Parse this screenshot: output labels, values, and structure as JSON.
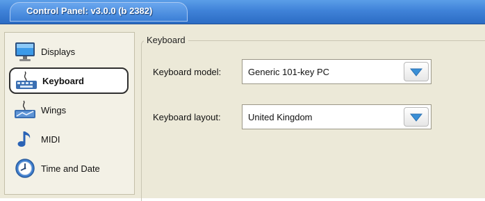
{
  "window": {
    "title": "Control Panel: v3.0.0 (b 2382)"
  },
  "sidebar": {
    "items": [
      {
        "label": "Displays",
        "icon": "monitor-icon",
        "selected": false
      },
      {
        "label": "Keyboard",
        "icon": "keyboard-icon",
        "selected": true
      },
      {
        "label": "Wings",
        "icon": "wings-icon",
        "selected": false
      },
      {
        "label": "MIDI",
        "icon": "music-note-icon",
        "selected": false
      },
      {
        "label": "Time and Date",
        "icon": "clock-icon",
        "selected": false
      }
    ]
  },
  "keyboard": {
    "group_title": "Keyboard",
    "model_label": "Keyboard model:",
    "model_value": "Generic 101-key PC",
    "layout_label": "Keyboard layout:",
    "layout_value": "United Kingdom"
  },
  "colors": {
    "titlebar": "#3f82d8",
    "panel_background": "#ece9d8",
    "dropdown_arrow": "#3a8fd6"
  }
}
